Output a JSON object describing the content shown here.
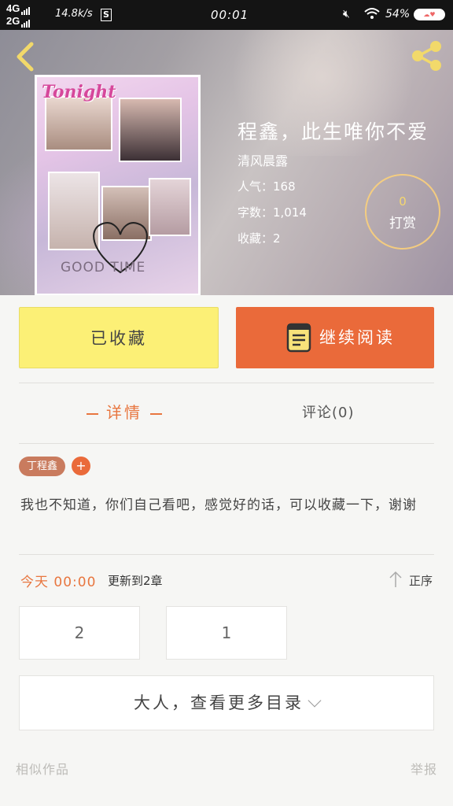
{
  "status_bar": {
    "network_top": "4G",
    "network_bottom": "2G",
    "speed": "14.8k/s",
    "s_badge": "S",
    "time": "00:01",
    "battery": "54%",
    "icons": [
      "mute-icon",
      "wifi-icon",
      "cloud-badge-icon"
    ]
  },
  "header": {
    "back_icon": "chevron-left-icon",
    "share_icon": "share-icon",
    "cover_title": "Tonight",
    "cover_bottom": "GOOD TIME",
    "title": "程鑫，此生唯你不爱",
    "author": "清风晨露",
    "popularity": "人气：168",
    "word_count": "字数：1,014",
    "collections": "收藏：2",
    "tip_count": "0",
    "tip_label": "打赏"
  },
  "actions": {
    "collected_label": "已收藏",
    "read_label": "继续阅读",
    "read_icon": "book-icon"
  },
  "tabs": {
    "detail": "详情",
    "comments": "评论(0)"
  },
  "tags": {
    "items": [
      "丁程鑫"
    ],
    "add": "+"
  },
  "description": "我也不知道，你们自己看吧，感觉好的话，可以收藏一下，谢谢",
  "update": {
    "time": "今天 00:00",
    "text": "更新到2章",
    "order_label": "正序",
    "order_icon": "arrow-up-icon"
  },
  "chapters": [
    "2",
    "1"
  ],
  "more_label": "大人，查看更多目录",
  "footer": {
    "similar": "相似作品",
    "report": "举报"
  },
  "colors": {
    "accent": "#ea6a3a",
    "collected_bg": "#fcf076",
    "tag_bg": "#c97b5e",
    "tip_gold": "#f5d76e"
  }
}
